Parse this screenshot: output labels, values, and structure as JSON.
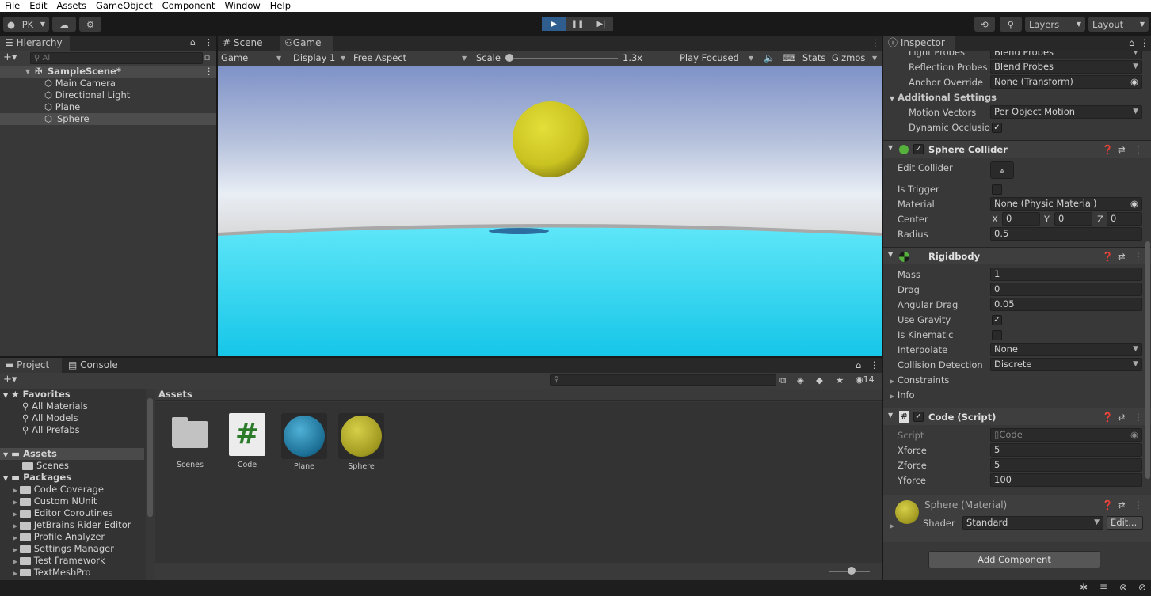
{
  "menu": [
    "File",
    "Edit",
    "Assets",
    "GameObject",
    "Component",
    "Window",
    "Help"
  ],
  "toolbar": {
    "account": "PK",
    "layers": "Layers",
    "layout": "Layout"
  },
  "hierarchy": {
    "tab": "Hierarchy",
    "search_placeholder": "All",
    "scene": "SampleScene*",
    "items": [
      "Main Camera",
      "Directional Light",
      "Plane",
      "Sphere"
    ]
  },
  "view": {
    "tabs": [
      "Scene",
      "Game"
    ],
    "game_dd": "Game",
    "display": "Display 1",
    "aspect": "Free Aspect",
    "scale_label": "Scale",
    "scale_value": "1.3x",
    "play_focused": "Play Focused",
    "stats": "Stats",
    "gizmos": "Gizmos"
  },
  "project": {
    "tabs": [
      "Project",
      "Console"
    ],
    "hidden_count": "14",
    "favorites": {
      "title": "Favorites",
      "items": [
        "All Materials",
        "All Models",
        "All Prefabs"
      ]
    },
    "assets": {
      "title": "Assets",
      "items": [
        "Scenes"
      ]
    },
    "packages": {
      "title": "Packages",
      "items": [
        "Code Coverage",
        "Custom NUnit",
        "Editor Coroutines",
        "JetBrains Rider Editor",
        "Profile Analyzer",
        "Settings Manager",
        "Test Framework",
        "TextMeshPro"
      ]
    },
    "breadcrumb": "Assets",
    "grid": [
      "Scenes",
      "Code",
      "Plane",
      "Sphere"
    ]
  },
  "inspector": {
    "tab": "Inspector",
    "top_rows": [
      {
        "label": "Light Probes",
        "value": "Blend Probes"
      },
      {
        "label": "Reflection Probes",
        "value": "Blend Probes"
      },
      {
        "label": "Anchor Override",
        "value": "None (Transform)"
      }
    ],
    "additional_settings": "Additional Settings",
    "motion_vectors": {
      "label": "Motion Vectors",
      "value": "Per Object Motion"
    },
    "dynamic_occlusion": {
      "label": "Dynamic Occlusion",
      "checked": true
    },
    "sphere_collider": {
      "title": "Sphere Collider",
      "edit_collider": "Edit Collider",
      "is_trigger": "Is Trigger",
      "material_label": "Material",
      "material_value": "None (Physic Material)",
      "center_label": "Center",
      "cx": "0",
      "cy": "0",
      "cz": "0",
      "radius_label": "Radius",
      "radius_value": "0.5"
    },
    "rigidbody": {
      "title": "Rigidbody",
      "mass_label": "Mass",
      "mass": "1",
      "drag_label": "Drag",
      "drag": "0",
      "angular_drag_label": "Angular Drag",
      "angular_drag": "0.05",
      "use_gravity": "Use Gravity",
      "is_kinematic": "Is Kinematic",
      "interpolate_label": "Interpolate",
      "interpolate": "None",
      "collision_label": "Collision Detection",
      "collision": "Discrete",
      "constraints": "Constraints",
      "info": "Info"
    },
    "code_script": {
      "title": "Code (Script)",
      "script_label": "Script",
      "script_value": "Code",
      "xforce_label": "Xforce",
      "xforce": "5",
      "zforce_label": "Zforce",
      "zforce": "5",
      "yforce_label": "Yforce",
      "yforce": "100"
    },
    "material": {
      "title": "Sphere (Material)",
      "shader_label": "Shader",
      "shader": "Standard",
      "edit": "Edit..."
    },
    "add_component": "Add Component"
  },
  "colors": {
    "accent": "#2e5d8e",
    "sphere": "#c9c220",
    "plane": "#3ad5f0",
    "sky_top": "#7e92c8",
    "sky_bottom": "#e9eef5"
  }
}
